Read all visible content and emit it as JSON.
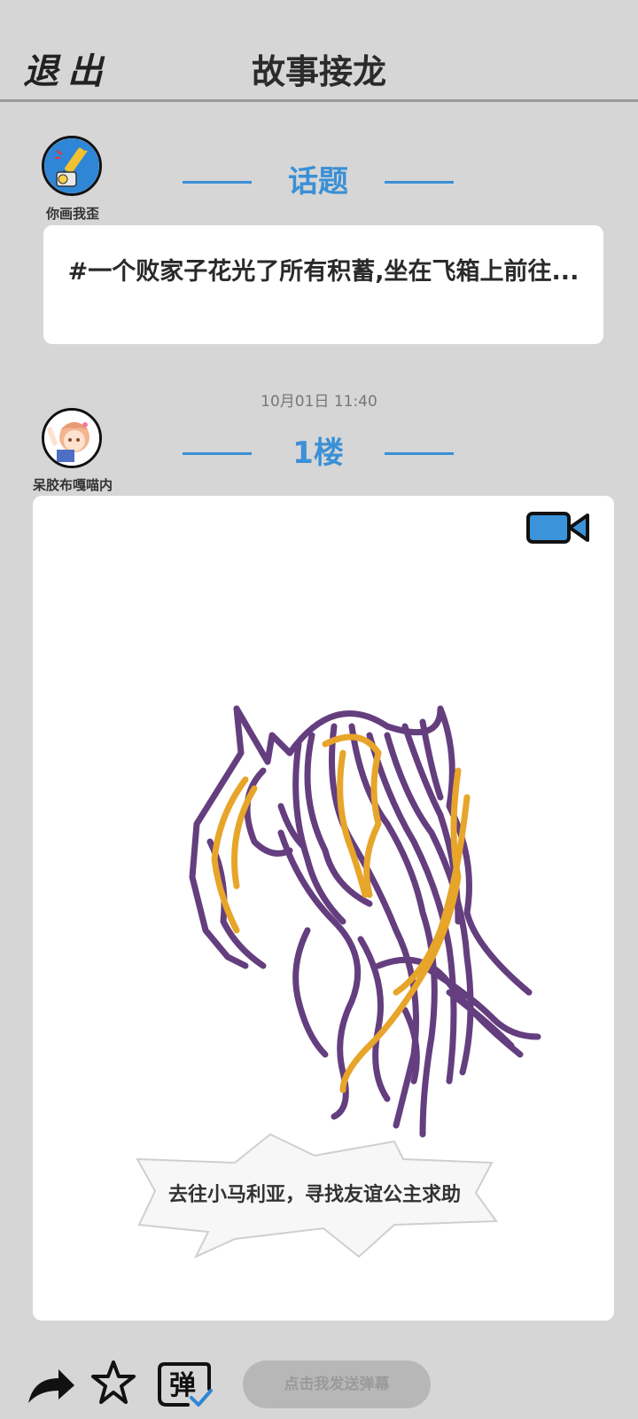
{
  "header": {
    "exit_label": "退出",
    "title": "故事接龙"
  },
  "topic": {
    "author_name": "你画我歪",
    "heading": "话题",
    "text": "#一个败家子花光了所有积蓄,坐在飞箱上前往..."
  },
  "floor": {
    "timestamp": "10月01日  11:40",
    "author_name": "呆胶布嘎喵内",
    "heading": "1楼",
    "caption": "去往小马利亚，寻找友谊公主求助"
  },
  "bottom_bar": {
    "danmu_placeholder": "点击我发送弹幕",
    "danmu_toggle_char": "弹"
  },
  "colors": {
    "accent": "#3a90d6",
    "background": "#d6d6d6",
    "drawing_purple": "#643e7e",
    "drawing_yellow": "#e7a52a"
  },
  "icons": {
    "share": "share-arrow-icon",
    "favorite": "star-icon",
    "danmu": "danmu-toggle-icon",
    "video": "video-camera-icon"
  }
}
